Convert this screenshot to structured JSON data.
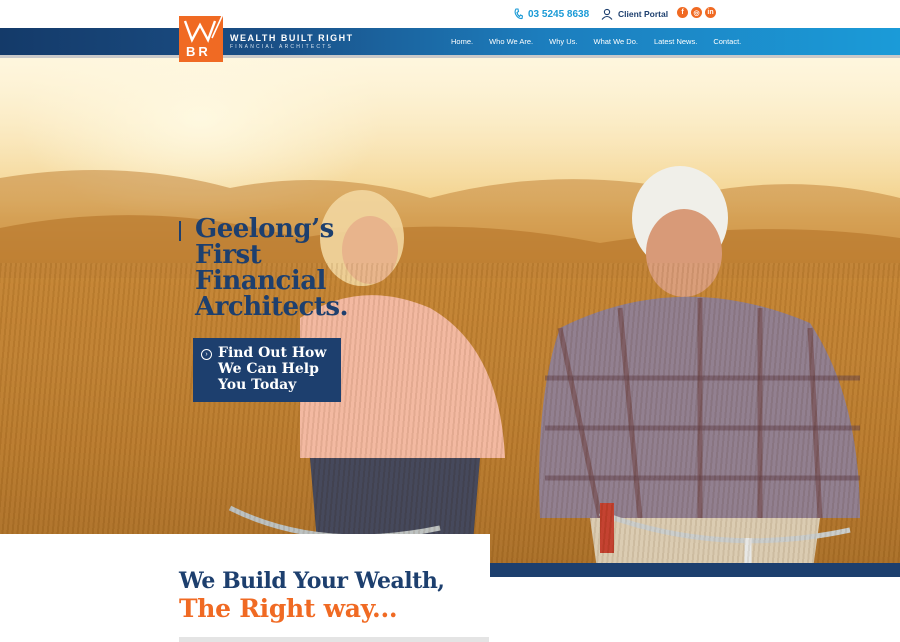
{
  "topbar": {
    "phone": "03 5245 8638",
    "phone_icon": "phone-icon",
    "client_portal_label": "Client Portal",
    "client_portal_icon": "user-icon",
    "social": [
      {
        "icon": "facebook-icon",
        "glyph": "f"
      },
      {
        "icon": "instagram-icon",
        "glyph": "◎"
      },
      {
        "icon": "linkedin-icon",
        "glyph": "in"
      }
    ]
  },
  "brand": {
    "logo_letters": "BR",
    "name": "WEALTH BUILT RIGHT",
    "subtitle": "FINANCIAL ARCHITECTS"
  },
  "nav": {
    "items": [
      "Home.",
      "Who We Are.",
      "Why Us.",
      "What We Do.",
      "Latest News.",
      "Contact."
    ]
  },
  "hero": {
    "headline_lines": [
      "Geelong’s",
      "First",
      "Financial",
      "Architects."
    ],
    "cta_lines": [
      "Find Out How",
      "We Can Help",
      "You Today"
    ],
    "cta_icon": "chevron-right-circle-icon"
  },
  "intro": {
    "line1": "We Build Your Wealth,",
    "line2": "The Right way..."
  },
  "colors": {
    "navy": "#1d3f6e",
    "orange": "#f06a23",
    "sky_blue": "#1b9bd8"
  }
}
